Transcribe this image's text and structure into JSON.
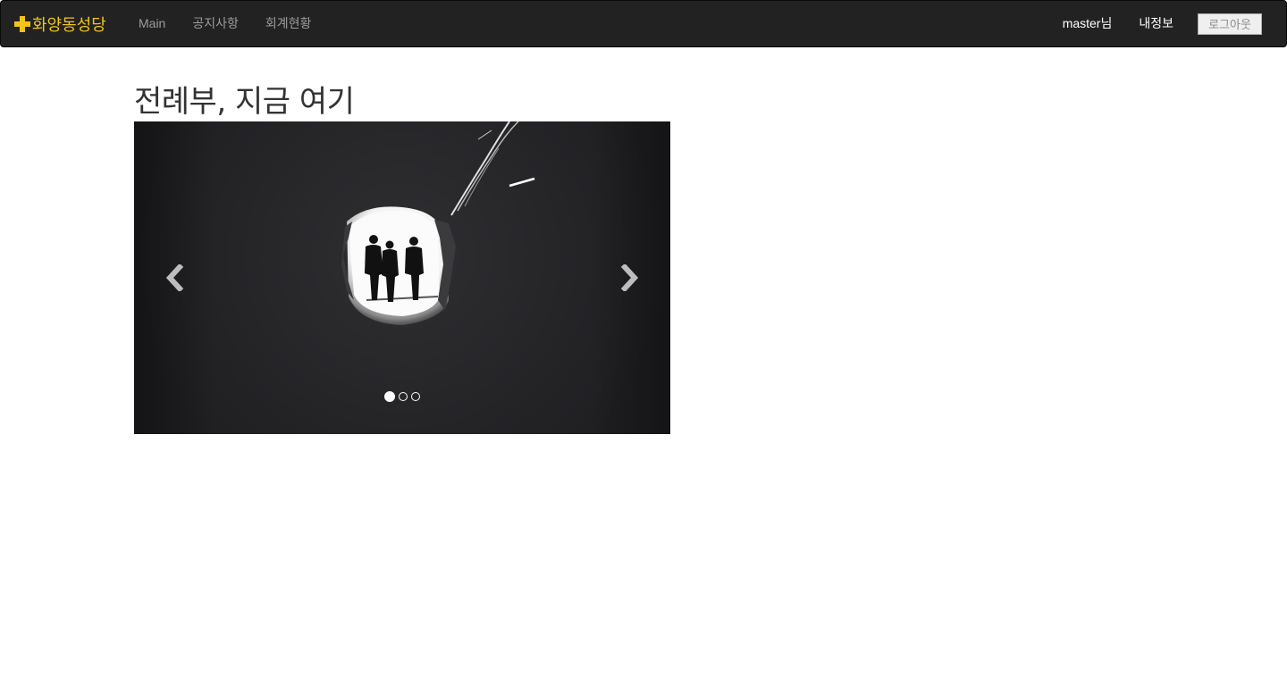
{
  "navbar": {
    "brand": "화양동성당",
    "brand_color": "#f0c419",
    "links": [
      "Main",
      "공지사항",
      "회계현황"
    ],
    "user_label": "master님",
    "profile_label": "내정보",
    "logout_label": "로그아웃"
  },
  "main": {
    "title": "전례부, 지금 여기"
  },
  "carousel": {
    "slide_count": 3,
    "active_slide": 1,
    "prev_icon": "chevron-left-icon",
    "next_icon": "chevron-right-icon"
  }
}
